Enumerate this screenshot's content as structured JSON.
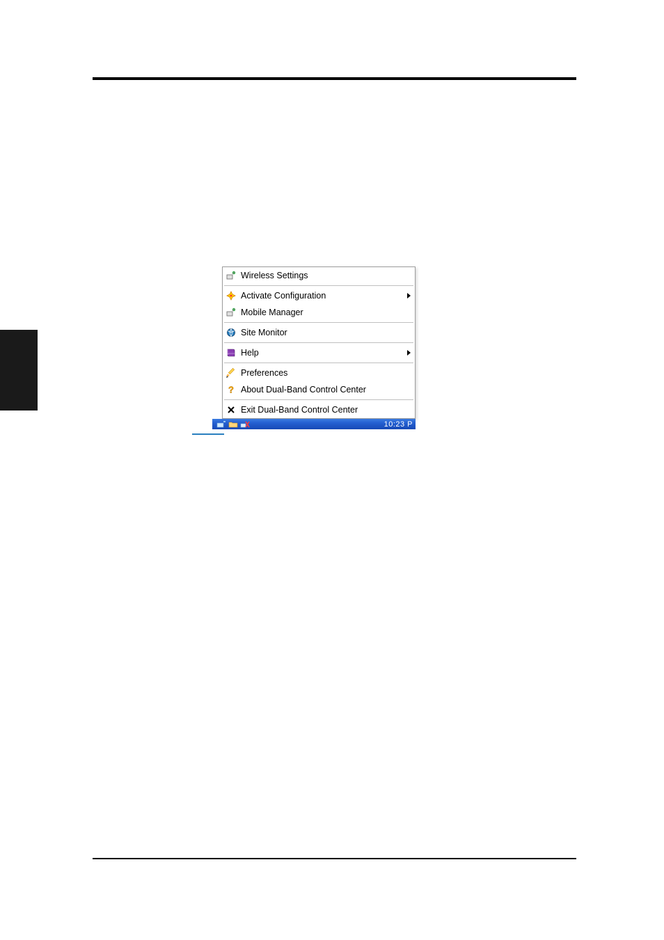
{
  "menu": {
    "items": [
      {
        "label": "Wireless Settings",
        "icon": "wireless-settings-icon",
        "submenu": false,
        "separator_after": true
      },
      {
        "label": "Activate Configuration",
        "icon": "activate-config-icon",
        "submenu": true,
        "separator_after": false
      },
      {
        "label": "Mobile Manager",
        "icon": "mobile-manager-icon",
        "submenu": false,
        "separator_after": true
      },
      {
        "label": "Site Monitor",
        "icon": "site-monitor-icon",
        "submenu": false,
        "separator_after": true
      },
      {
        "label": "Help",
        "icon": "help-book-icon",
        "submenu": true,
        "separator_after": true
      },
      {
        "label": "Preferences",
        "icon": "preferences-pencil-icon",
        "submenu": false,
        "separator_after": false
      },
      {
        "label": "About Dual-Band Control Center",
        "icon": "about-question-icon",
        "submenu": false,
        "separator_after": true
      },
      {
        "label": "Exit Dual-Band Control Center",
        "icon": "exit-x-icon",
        "submenu": false,
        "separator_after": false
      }
    ]
  },
  "taskbar": {
    "clock": "10:23 P",
    "tray_icons": [
      {
        "name": "network-card-icon",
        "color": "#cfe8ff"
      },
      {
        "name": "folder-icon",
        "color": "#ffd57a"
      },
      {
        "name": "wireless-disconnected-icon",
        "color": "#ff4d4d"
      }
    ]
  }
}
